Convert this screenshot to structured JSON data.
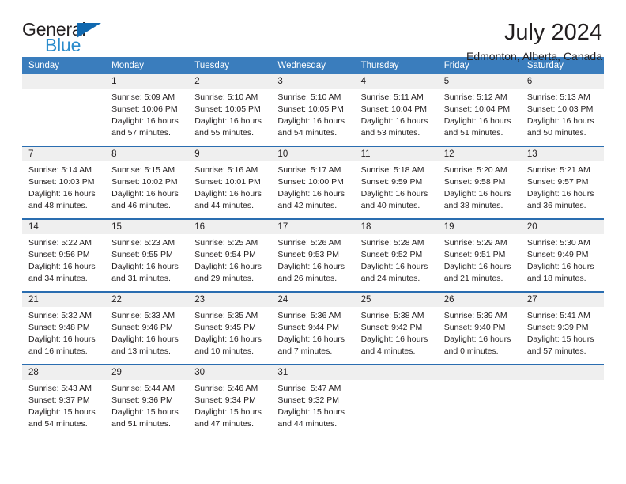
{
  "brand": {
    "name_top": "General",
    "name_bottom": "Blue",
    "triangle_color": "#1169b0",
    "blue_text_color": "#2b8ccc"
  },
  "header": {
    "title": "July 2024",
    "subtitle": "Edmonton, Alberta, Canada"
  },
  "theme": {
    "header_blue": "#3a7dbd",
    "separator_blue": "#2a6db0",
    "daynum_band": "#efefef",
    "text": "#231f20"
  },
  "calendar": {
    "weekday_headers": [
      "Sunday",
      "Monday",
      "Tuesday",
      "Wednesday",
      "Thursday",
      "Friday",
      "Saturday"
    ],
    "weeks": [
      [
        {
          "day": "",
          "lines": []
        },
        {
          "day": "1",
          "lines": [
            "Sunrise: 5:09 AM",
            "Sunset: 10:06 PM",
            "Daylight: 16 hours",
            "and 57 minutes."
          ]
        },
        {
          "day": "2",
          "lines": [
            "Sunrise: 5:10 AM",
            "Sunset: 10:05 PM",
            "Daylight: 16 hours",
            "and 55 minutes."
          ]
        },
        {
          "day": "3",
          "lines": [
            "Sunrise: 5:10 AM",
            "Sunset: 10:05 PM",
            "Daylight: 16 hours",
            "and 54 minutes."
          ]
        },
        {
          "day": "4",
          "lines": [
            "Sunrise: 5:11 AM",
            "Sunset: 10:04 PM",
            "Daylight: 16 hours",
            "and 53 minutes."
          ]
        },
        {
          "day": "5",
          "lines": [
            "Sunrise: 5:12 AM",
            "Sunset: 10:04 PM",
            "Daylight: 16 hours",
            "and 51 minutes."
          ]
        },
        {
          "day": "6",
          "lines": [
            "Sunrise: 5:13 AM",
            "Sunset: 10:03 PM",
            "Daylight: 16 hours",
            "and 50 minutes."
          ]
        }
      ],
      [
        {
          "day": "7",
          "lines": [
            "Sunrise: 5:14 AM",
            "Sunset: 10:03 PM",
            "Daylight: 16 hours",
            "and 48 minutes."
          ]
        },
        {
          "day": "8",
          "lines": [
            "Sunrise: 5:15 AM",
            "Sunset: 10:02 PM",
            "Daylight: 16 hours",
            "and 46 minutes."
          ]
        },
        {
          "day": "9",
          "lines": [
            "Sunrise: 5:16 AM",
            "Sunset: 10:01 PM",
            "Daylight: 16 hours",
            "and 44 minutes."
          ]
        },
        {
          "day": "10",
          "lines": [
            "Sunrise: 5:17 AM",
            "Sunset: 10:00 PM",
            "Daylight: 16 hours",
            "and 42 minutes."
          ]
        },
        {
          "day": "11",
          "lines": [
            "Sunrise: 5:18 AM",
            "Sunset: 9:59 PM",
            "Daylight: 16 hours",
            "and 40 minutes."
          ]
        },
        {
          "day": "12",
          "lines": [
            "Sunrise: 5:20 AM",
            "Sunset: 9:58 PM",
            "Daylight: 16 hours",
            "and 38 minutes."
          ]
        },
        {
          "day": "13",
          "lines": [
            "Sunrise: 5:21 AM",
            "Sunset: 9:57 PM",
            "Daylight: 16 hours",
            "and 36 minutes."
          ]
        }
      ],
      [
        {
          "day": "14",
          "lines": [
            "Sunrise: 5:22 AM",
            "Sunset: 9:56 PM",
            "Daylight: 16 hours",
            "and 34 minutes."
          ]
        },
        {
          "day": "15",
          "lines": [
            "Sunrise: 5:23 AM",
            "Sunset: 9:55 PM",
            "Daylight: 16 hours",
            "and 31 minutes."
          ]
        },
        {
          "day": "16",
          "lines": [
            "Sunrise: 5:25 AM",
            "Sunset: 9:54 PM",
            "Daylight: 16 hours",
            "and 29 minutes."
          ]
        },
        {
          "day": "17",
          "lines": [
            "Sunrise: 5:26 AM",
            "Sunset: 9:53 PM",
            "Daylight: 16 hours",
            "and 26 minutes."
          ]
        },
        {
          "day": "18",
          "lines": [
            "Sunrise: 5:28 AM",
            "Sunset: 9:52 PM",
            "Daylight: 16 hours",
            "and 24 minutes."
          ]
        },
        {
          "day": "19",
          "lines": [
            "Sunrise: 5:29 AM",
            "Sunset: 9:51 PM",
            "Daylight: 16 hours",
            "and 21 minutes."
          ]
        },
        {
          "day": "20",
          "lines": [
            "Sunrise: 5:30 AM",
            "Sunset: 9:49 PM",
            "Daylight: 16 hours",
            "and 18 minutes."
          ]
        }
      ],
      [
        {
          "day": "21",
          "lines": [
            "Sunrise: 5:32 AM",
            "Sunset: 9:48 PM",
            "Daylight: 16 hours",
            "and 16 minutes."
          ]
        },
        {
          "day": "22",
          "lines": [
            "Sunrise: 5:33 AM",
            "Sunset: 9:46 PM",
            "Daylight: 16 hours",
            "and 13 minutes."
          ]
        },
        {
          "day": "23",
          "lines": [
            "Sunrise: 5:35 AM",
            "Sunset: 9:45 PM",
            "Daylight: 16 hours",
            "and 10 minutes."
          ]
        },
        {
          "day": "24",
          "lines": [
            "Sunrise: 5:36 AM",
            "Sunset: 9:44 PM",
            "Daylight: 16 hours",
            "and 7 minutes."
          ]
        },
        {
          "day": "25",
          "lines": [
            "Sunrise: 5:38 AM",
            "Sunset: 9:42 PM",
            "Daylight: 16 hours",
            "and 4 minutes."
          ]
        },
        {
          "day": "26",
          "lines": [
            "Sunrise: 5:39 AM",
            "Sunset: 9:40 PM",
            "Daylight: 16 hours",
            "and 0 minutes."
          ]
        },
        {
          "day": "27",
          "lines": [
            "Sunrise: 5:41 AM",
            "Sunset: 9:39 PM",
            "Daylight: 15 hours",
            "and 57 minutes."
          ]
        }
      ],
      [
        {
          "day": "28",
          "lines": [
            "Sunrise: 5:43 AM",
            "Sunset: 9:37 PM",
            "Daylight: 15 hours",
            "and 54 minutes."
          ]
        },
        {
          "day": "29",
          "lines": [
            "Sunrise: 5:44 AM",
            "Sunset: 9:36 PM",
            "Daylight: 15 hours",
            "and 51 minutes."
          ]
        },
        {
          "day": "30",
          "lines": [
            "Sunrise: 5:46 AM",
            "Sunset: 9:34 PM",
            "Daylight: 15 hours",
            "and 47 minutes."
          ]
        },
        {
          "day": "31",
          "lines": [
            "Sunrise: 5:47 AM",
            "Sunset: 9:32 PM",
            "Daylight: 15 hours",
            "and 44 minutes."
          ]
        },
        {
          "day": "",
          "lines": []
        },
        {
          "day": "",
          "lines": []
        },
        {
          "day": "",
          "lines": []
        }
      ]
    ]
  }
}
